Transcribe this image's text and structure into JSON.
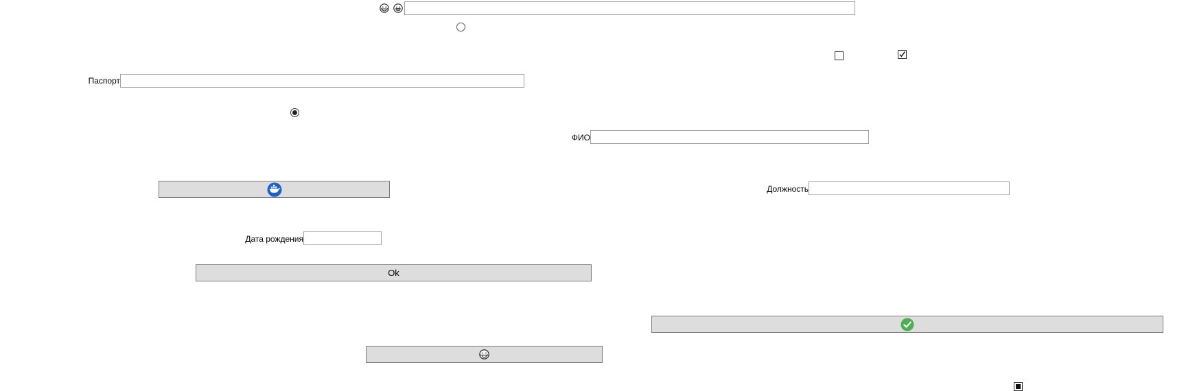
{
  "form": {
    "top_icons": [
      "laughing-emoji-icon",
      "grinning-emoji-icon"
    ],
    "passport_label": "Паспорт",
    "passport_value": "",
    "fio_label": "ФИО",
    "fio_value": "",
    "position_label": "Должность",
    "position_value": "",
    "birthdate_label": "Дата рождения",
    "birthdate_value": "",
    "ok_label": "Ok",
    "checkbox_1_checked": false,
    "checkbox_2_checked": true,
    "radio_1_selected": false,
    "radio_2_selected": true
  },
  "buttons": {
    "docker_button_icon": "docker-whale-icon",
    "confirm_button_icon": "green-check-icon",
    "emoji_button_icon": "laughing-emoji-icon"
  },
  "colors": {
    "button_bg": "#dddddd",
    "button_border": "#7a7a7a",
    "field_border": "#a0a0a0",
    "docker_blue": "#1d63c4",
    "check_green": "#4caf50"
  }
}
